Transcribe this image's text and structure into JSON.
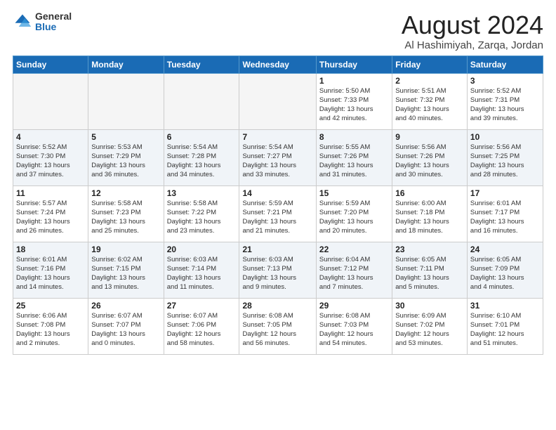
{
  "logo": {
    "general": "General",
    "blue": "Blue"
  },
  "header": {
    "title": "August 2024",
    "subtitle": "Al Hashimiyah, Zarqa, Jordan"
  },
  "weekdays": [
    "Sunday",
    "Monday",
    "Tuesday",
    "Wednesday",
    "Thursday",
    "Friday",
    "Saturday"
  ],
  "weeks": [
    [
      {
        "day": "",
        "info": ""
      },
      {
        "day": "",
        "info": ""
      },
      {
        "day": "",
        "info": ""
      },
      {
        "day": "",
        "info": ""
      },
      {
        "day": "1",
        "info": "Sunrise: 5:50 AM\nSunset: 7:33 PM\nDaylight: 13 hours\nand 42 minutes."
      },
      {
        "day": "2",
        "info": "Sunrise: 5:51 AM\nSunset: 7:32 PM\nDaylight: 13 hours\nand 40 minutes."
      },
      {
        "day": "3",
        "info": "Sunrise: 5:52 AM\nSunset: 7:31 PM\nDaylight: 13 hours\nand 39 minutes."
      }
    ],
    [
      {
        "day": "4",
        "info": "Sunrise: 5:52 AM\nSunset: 7:30 PM\nDaylight: 13 hours\nand 37 minutes."
      },
      {
        "day": "5",
        "info": "Sunrise: 5:53 AM\nSunset: 7:29 PM\nDaylight: 13 hours\nand 36 minutes."
      },
      {
        "day": "6",
        "info": "Sunrise: 5:54 AM\nSunset: 7:28 PM\nDaylight: 13 hours\nand 34 minutes."
      },
      {
        "day": "7",
        "info": "Sunrise: 5:54 AM\nSunset: 7:27 PM\nDaylight: 13 hours\nand 33 minutes."
      },
      {
        "day": "8",
        "info": "Sunrise: 5:55 AM\nSunset: 7:26 PM\nDaylight: 13 hours\nand 31 minutes."
      },
      {
        "day": "9",
        "info": "Sunrise: 5:56 AM\nSunset: 7:26 PM\nDaylight: 13 hours\nand 30 minutes."
      },
      {
        "day": "10",
        "info": "Sunrise: 5:56 AM\nSunset: 7:25 PM\nDaylight: 13 hours\nand 28 minutes."
      }
    ],
    [
      {
        "day": "11",
        "info": "Sunrise: 5:57 AM\nSunset: 7:24 PM\nDaylight: 13 hours\nand 26 minutes."
      },
      {
        "day": "12",
        "info": "Sunrise: 5:58 AM\nSunset: 7:23 PM\nDaylight: 13 hours\nand 25 minutes."
      },
      {
        "day": "13",
        "info": "Sunrise: 5:58 AM\nSunset: 7:22 PM\nDaylight: 13 hours\nand 23 minutes."
      },
      {
        "day": "14",
        "info": "Sunrise: 5:59 AM\nSunset: 7:21 PM\nDaylight: 13 hours\nand 21 minutes."
      },
      {
        "day": "15",
        "info": "Sunrise: 5:59 AM\nSunset: 7:20 PM\nDaylight: 13 hours\nand 20 minutes."
      },
      {
        "day": "16",
        "info": "Sunrise: 6:00 AM\nSunset: 7:18 PM\nDaylight: 13 hours\nand 18 minutes."
      },
      {
        "day": "17",
        "info": "Sunrise: 6:01 AM\nSunset: 7:17 PM\nDaylight: 13 hours\nand 16 minutes."
      }
    ],
    [
      {
        "day": "18",
        "info": "Sunrise: 6:01 AM\nSunset: 7:16 PM\nDaylight: 13 hours\nand 14 minutes."
      },
      {
        "day": "19",
        "info": "Sunrise: 6:02 AM\nSunset: 7:15 PM\nDaylight: 13 hours\nand 13 minutes."
      },
      {
        "day": "20",
        "info": "Sunrise: 6:03 AM\nSunset: 7:14 PM\nDaylight: 13 hours\nand 11 minutes."
      },
      {
        "day": "21",
        "info": "Sunrise: 6:03 AM\nSunset: 7:13 PM\nDaylight: 13 hours\nand 9 minutes."
      },
      {
        "day": "22",
        "info": "Sunrise: 6:04 AM\nSunset: 7:12 PM\nDaylight: 13 hours\nand 7 minutes."
      },
      {
        "day": "23",
        "info": "Sunrise: 6:05 AM\nSunset: 7:11 PM\nDaylight: 13 hours\nand 5 minutes."
      },
      {
        "day": "24",
        "info": "Sunrise: 6:05 AM\nSunset: 7:09 PM\nDaylight: 13 hours\nand 4 minutes."
      }
    ],
    [
      {
        "day": "25",
        "info": "Sunrise: 6:06 AM\nSunset: 7:08 PM\nDaylight: 13 hours\nand 2 minutes."
      },
      {
        "day": "26",
        "info": "Sunrise: 6:07 AM\nSunset: 7:07 PM\nDaylight: 13 hours\nand 0 minutes."
      },
      {
        "day": "27",
        "info": "Sunrise: 6:07 AM\nSunset: 7:06 PM\nDaylight: 12 hours\nand 58 minutes."
      },
      {
        "day": "28",
        "info": "Sunrise: 6:08 AM\nSunset: 7:05 PM\nDaylight: 12 hours\nand 56 minutes."
      },
      {
        "day": "29",
        "info": "Sunrise: 6:08 AM\nSunset: 7:03 PM\nDaylight: 12 hours\nand 54 minutes."
      },
      {
        "day": "30",
        "info": "Sunrise: 6:09 AM\nSunset: 7:02 PM\nDaylight: 12 hours\nand 53 minutes."
      },
      {
        "day": "31",
        "info": "Sunrise: 6:10 AM\nSunset: 7:01 PM\nDaylight: 12 hours\nand 51 minutes."
      }
    ]
  ]
}
